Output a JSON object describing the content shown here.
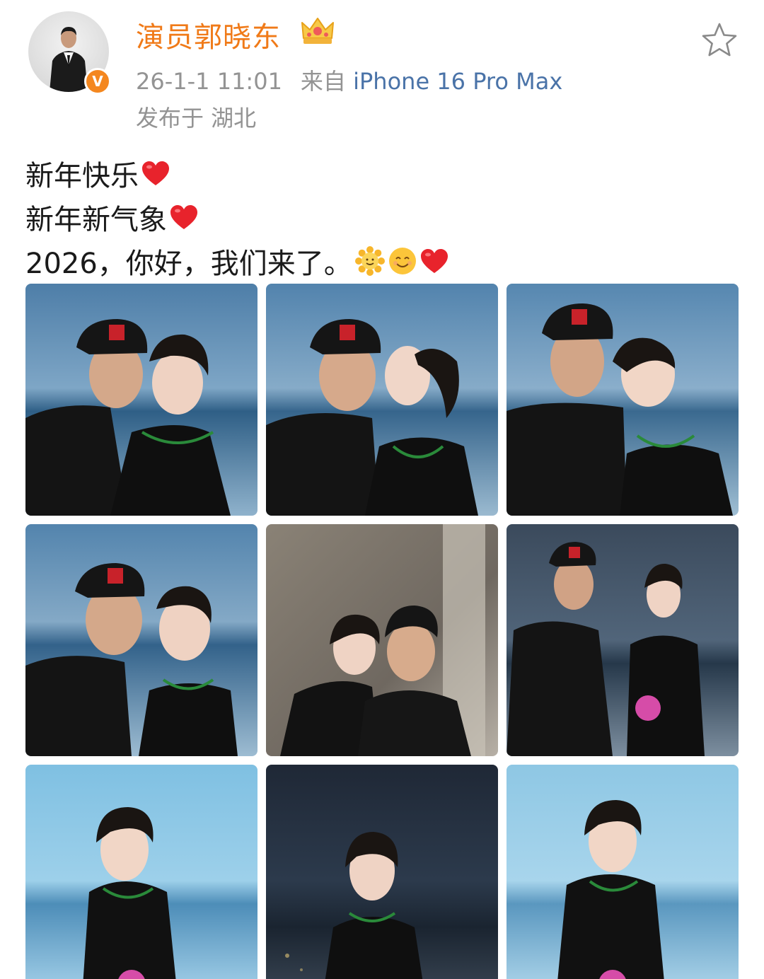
{
  "post": {
    "author": {
      "name": "演员郭晓东",
      "verified_badge": "V",
      "avatar_icon": "man-in-suit-avatar",
      "member_icon": "crown-icon"
    },
    "meta": {
      "date": "26-1-1 11:01",
      "source_prefix": "来自",
      "device": "iPhone 16 Pro Max",
      "location": "发布于 湖北"
    },
    "favorite_icon": "star-outline-icon",
    "text_lines": [
      {
        "text": "新年快乐",
        "emojis": [
          "heart"
        ]
      },
      {
        "text": "新年新气象",
        "emojis": [
          "heart"
        ]
      },
      {
        "text": "2026，你好，我们来了。",
        "emojis": [
          "sunflower",
          "smile",
          "heart"
        ]
      }
    ],
    "photos": [
      {
        "name": "couple-photo-1",
        "bg": "sea"
      },
      {
        "name": "couple-photo-2",
        "bg": "sea"
      },
      {
        "name": "couple-photo-3",
        "bg": "sea"
      },
      {
        "name": "couple-photo-4",
        "bg": "sea"
      },
      {
        "name": "couple-photo-5",
        "bg": "indoor"
      },
      {
        "name": "couple-photo-6",
        "bg": "dusk"
      },
      {
        "name": "woman-portrait-1",
        "bg": "sky"
      },
      {
        "name": "woman-portrait-2",
        "bg": "night"
      },
      {
        "name": "woman-portrait-3",
        "bg": "sky"
      }
    ]
  },
  "colors": {
    "username": "#f07a18",
    "meta_gray": "#939393",
    "device_link": "#4a73a8",
    "verified_orange": "#f4871f",
    "heart_red": "#e8232c"
  }
}
